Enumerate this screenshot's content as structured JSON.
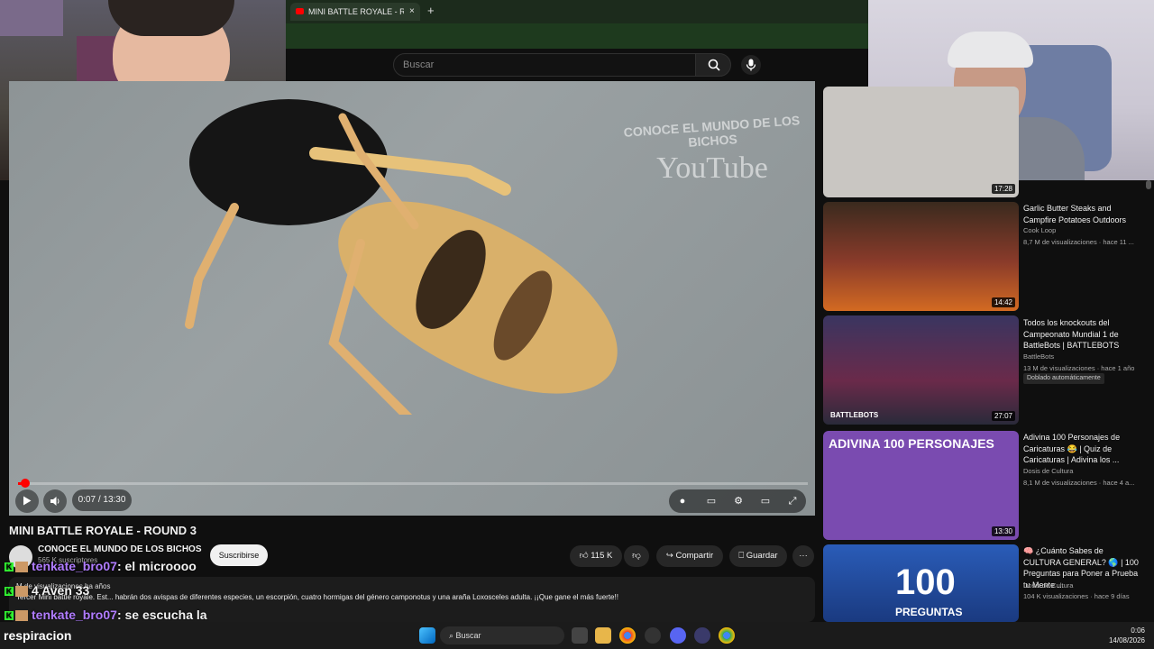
{
  "browser": {
    "tab_title": "MINI BATTLE ROYALE - ROUND",
    "tab_close": "×",
    "new_tab": "+"
  },
  "youtube": {
    "search_placeholder": "Buscar"
  },
  "player": {
    "progress_fraction": 0.009,
    "time": "0:07 / 13:30",
    "watermark_line1": "CONOCE EL MUNDO DE LOS BICHOS",
    "watermark_line2": "YouTube"
  },
  "video": {
    "title": "MINI BATTLE ROYALE - ROUND 3",
    "channel": "CONOCE EL MUNDO DE LOS BICHOS",
    "subscribers": "565 K suscriptores",
    "subscribe_label": "Suscribirse",
    "likes": "115 K",
    "share_label": "Compartir",
    "save_label": "Guardar",
    "more_label": "···",
    "description_stats": "M de visualizaciones ha años",
    "description_text": "Tercer Mini battle royale. Est... habrán dos avispas de diferentes especies, un escorpión, cuatro hormigas del género camponotus y una araña Loxosceles adulta. ¡¡Que gane el más fuerte!!"
  },
  "chat": [
    {
      "user": "tenkate_bro07",
      "message": ": el microooo"
    },
    {
      "user": "4 Aven 33",
      "message": ""
    },
    {
      "user": "tenkate_bro07",
      "message": ": se escucha la"
    }
  ],
  "overlay_caption": "respiracion",
  "sidebar": [
    {
      "duration": "17:28",
      "title": "",
      "channel": "",
      "meta": "",
      "thumb_color": "#c9c6c2"
    },
    {
      "duration": "14:42",
      "title": "Garlic Butter Steaks and Campfire Potatoes Outdoors",
      "channel": "Cook Loop",
      "meta": "8,7 M de visualizaciones · hace 11 ...",
      "thumb_color": "#8a3b2a"
    },
    {
      "duration": "27:07",
      "title": "Todos los knockouts del Campeonato Mundial 1 de BattleBots | BATTLEBOTS",
      "channel": "BattleBots",
      "meta": "13 M de visualizaciones · hace 1 año",
      "badge": "Doblado automáticamente",
      "thumb_color": "#3a3560",
      "thumb_label": "BATTLEBOTS"
    },
    {
      "duration": "13:30",
      "title": "Adivina 100 Personajes de Caricaturas 😂 | Quiz de Caricaturas | Adivina los ...",
      "channel": "Dosis de Cultura",
      "meta": "8,1 M de visualizaciones · hace 4 a...",
      "thumb_color": "#7a4bb0",
      "thumb_label": "ADIVINA 100 PERSONAJES"
    },
    {
      "duration": "",
      "title": "🧠 ¿Cuánto Sabes de CULTURA GENERAL? 🌎 | 100 Preguntas para Poner a Prueba tu Mente ...",
      "channel": "Dosis de Cultura",
      "meta": "104 K visualizaciones · hace 9 días",
      "thumb_color": "#2a5cb8",
      "thumb_label": "100",
      "thumb_label2": "PREGUNTAS"
    }
  ],
  "taskbar": {
    "search_label": "Buscar",
    "time": "0:06",
    "date": "14/08/2026"
  }
}
